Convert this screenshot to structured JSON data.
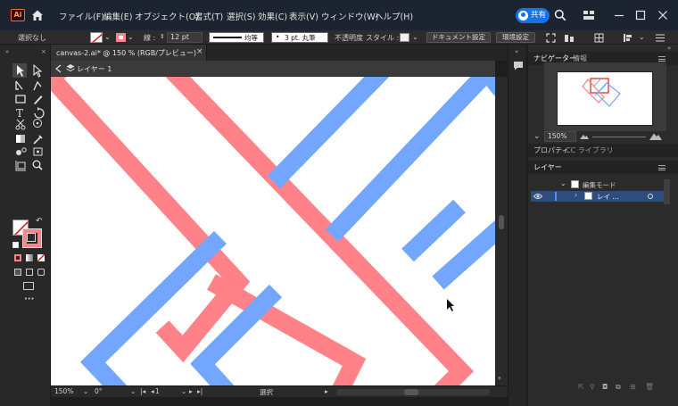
{
  "menubar": {
    "app_icon": "Ai",
    "items": [
      "ファイル(F)",
      "編集(E)",
      "オブジェクト(O)",
      "書式(T)",
      "選択(S)",
      "効果(C)",
      "表示(V)",
      "ウィンドウ(W)",
      "ヘルプ(H)"
    ],
    "share_label": "共有",
    "icons": [
      "home-icon",
      "search-icon",
      "workspace-icon",
      "minimize-icon",
      "maximize-icon",
      "close-icon"
    ]
  },
  "control_bar": {
    "selection": "選択なし",
    "stroke_label": "線 :",
    "stroke_width": "12 pt",
    "stroke_profile": "均等",
    "brush": "3 pt. 丸筆",
    "opacity_label": "不透明度",
    "style_label": "スタイル :",
    "doc_settings": "ドキュメント設定",
    "prefs": "環境設定",
    "stroke_color": "#f38787"
  },
  "document": {
    "tab_title": "canvas-2.ai* @ 150 % (RGB/プレビュー)",
    "tab_close": "×",
    "breadcrumb_layer": "レイヤー 1"
  },
  "status": {
    "zoom": "150%",
    "angle": "0°",
    "artboard": "1",
    "tool": "選択"
  },
  "panels": {
    "navigator_tab": "ナビゲーター",
    "info_tab": "情報",
    "navigator_zoom": "150%",
    "properties_tab": "プロパティ",
    "libraries_tab": "CC ライブラリ",
    "layers_tab": "レイヤー",
    "layer_rows": [
      {
        "name": "編集モード"
      },
      {
        "name": "レイ ..."
      }
    ]
  },
  "colors": {
    "red": "#ff8288",
    "blue": "#73a6ff",
    "accent": "#1473e6"
  }
}
